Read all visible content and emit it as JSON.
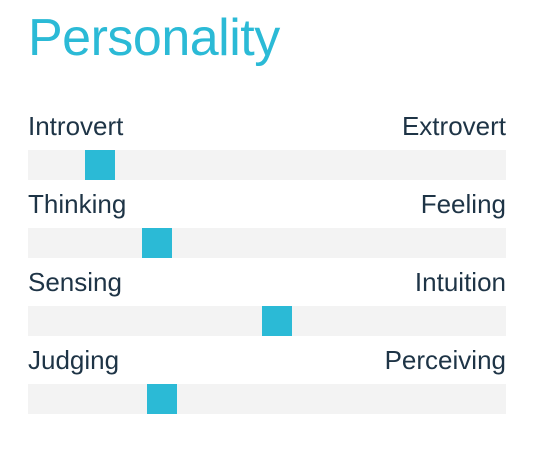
{
  "title": "Personality",
  "colors": {
    "accent": "#2bbad6",
    "text": "#1e3446",
    "track": "#f3f3f3"
  },
  "traits": [
    {
      "left": "Introvert",
      "right": "Extrovert",
      "value": 0.15
    },
    {
      "left": "Thinking",
      "right": "Feeling",
      "value": 0.27
    },
    {
      "left": "Sensing",
      "right": "Intuition",
      "value": 0.52
    },
    {
      "left": "Judging",
      "right": "Perceiving",
      "value": 0.28
    }
  ]
}
